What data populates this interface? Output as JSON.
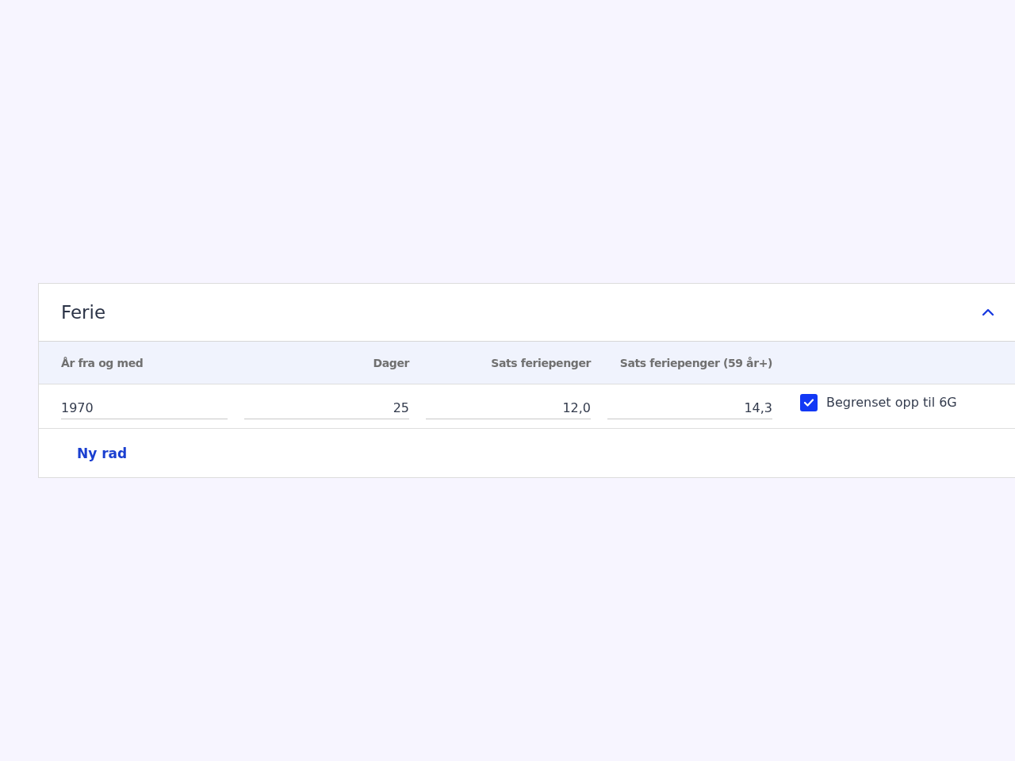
{
  "section": {
    "title": "Ferie",
    "expanded": true
  },
  "table": {
    "columns": [
      "År fra og med",
      "Dager",
      "Sats feriepenger",
      "Sats feriepenger (59 år+)"
    ],
    "rows": [
      {
        "cells": [
          "1970",
          "25",
          "12,0",
          "14,3"
        ],
        "option": {
          "label": "Begrenset opp til 6G",
          "checked": true
        }
      }
    ]
  },
  "add_row_button": "Ny rad"
}
